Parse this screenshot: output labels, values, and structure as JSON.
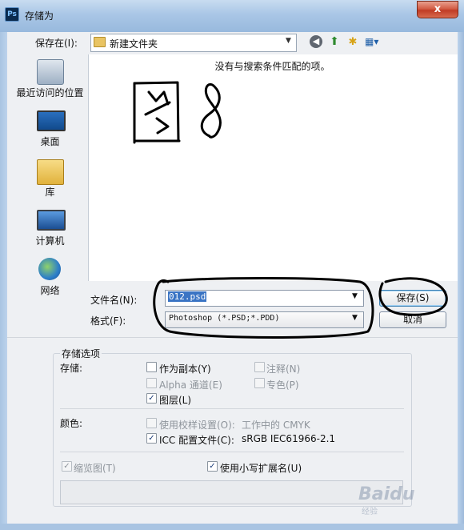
{
  "window": {
    "title": "存储为",
    "app_icon": "Ps",
    "close_glyph": "x"
  },
  "topbar": {
    "save_in_label": "保存在(I):",
    "current_folder": "新建文件夹",
    "icons": [
      "back-icon",
      "up-folder-icon",
      "new-folder-icon",
      "view-menu-icon"
    ]
  },
  "places": [
    {
      "label": "最近访问的位置",
      "icon": "recent-places-icon"
    },
    {
      "label": "桌面",
      "icon": "desktop-icon"
    },
    {
      "label": "库",
      "icon": "library-icon"
    },
    {
      "label": "计算机",
      "icon": "computer-icon"
    },
    {
      "label": "网络",
      "icon": "network-icon"
    }
  ],
  "file_list": {
    "empty_message": "没有与搜索条件匹配的项。"
  },
  "filename": {
    "label": "文件名(N):",
    "value": "012.psd"
  },
  "format": {
    "label": "格式(F):",
    "value": "Photoshop (*.PSD;*.PDD)"
  },
  "buttons": {
    "save": "保存(S)",
    "cancel": "取消"
  },
  "options": {
    "group_title": "存储选项",
    "storage_label": "存储:",
    "as_copy": {
      "label": "作为副本(Y)",
      "checked": false,
      "enabled": true
    },
    "annotations": {
      "label": "注释(N)",
      "checked": false,
      "enabled": false
    },
    "alpha_channels": {
      "label": "Alpha 通道(E)",
      "checked": false,
      "enabled": false
    },
    "spot_colors": {
      "label": "专色(P)",
      "checked": false,
      "enabled": false
    },
    "layers": {
      "label": "图层(L)",
      "checked": true,
      "enabled": true
    },
    "color_label": "颜色:",
    "use_proof": {
      "label": "使用校样设置(O):",
      "checked": false,
      "enabled": false,
      "value": "工作中的 CMYK"
    },
    "icc_profile": {
      "label": "ICC 配置文件(C):",
      "checked": true,
      "enabled": true,
      "value": "sRGB IEC61966-2.1"
    },
    "thumbnail": {
      "label": "缩览图(T)",
      "checked": true,
      "enabled": false
    },
    "lowercase_ext": {
      "label": "使用小写扩展名(U)",
      "checked": true,
      "enabled": true
    }
  },
  "watermark": {
    "logo": "Baidu",
    "sub": "经验"
  }
}
